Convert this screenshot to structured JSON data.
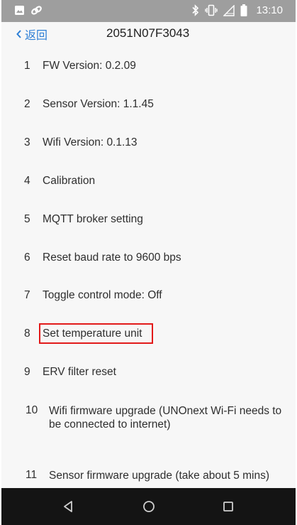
{
  "status_bar": {
    "time": "13:10",
    "left_icons": [
      "image-icon",
      "link-icon"
    ],
    "right_icons": [
      "bluetooth-icon",
      "vibrate-icon",
      "signal-off-icon",
      "battery-icon"
    ]
  },
  "header": {
    "back_label": "返回",
    "title": "2051N07F3043"
  },
  "menu": {
    "items": [
      {
        "number": "1",
        "label": "FW Version: 0.2.09"
      },
      {
        "number": "2",
        "label": "Sensor Version: 1.1.45"
      },
      {
        "number": "3",
        "label": "Wifi Version: 0.1.13"
      },
      {
        "number": "4",
        "label": "Calibration"
      },
      {
        "number": "5",
        "label": "MQTT broker setting"
      },
      {
        "number": "6",
        "label": "Reset baud rate to 9600 bps"
      },
      {
        "number": "7",
        "label": "Toggle control mode: Off"
      },
      {
        "number": "8",
        "label": "Set temperature unit"
      },
      {
        "number": "9",
        "label": "ERV filter reset"
      },
      {
        "number": "10",
        "label": "Wifi firmware upgrade (UNOnext Wi-Fi needs to be connected to internet)"
      },
      {
        "number": "11",
        "label": "Sensor firmware upgrade (take about 5 mins)"
      }
    ],
    "highlighted_item": "8"
  },
  "nav_bar": {
    "icons": [
      "back-triangle-icon",
      "home-circle-icon",
      "recents-square-icon"
    ]
  },
  "colors": {
    "status_bar": "#9e9e9e",
    "accent": "#2d7fd6",
    "highlight": "#e21a1a",
    "nav_bar": "#141414"
  }
}
